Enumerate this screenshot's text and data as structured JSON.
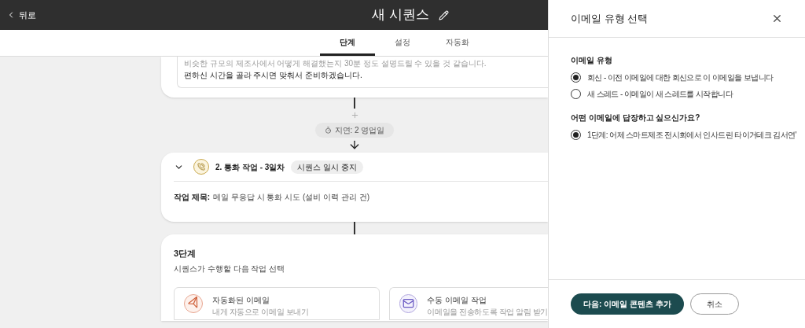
{
  "header": {
    "back": "뒤로",
    "title": "새 시퀀스"
  },
  "tabs": [
    {
      "label": "단계",
      "selected": true
    },
    {
      "label": "설정",
      "selected": false
    },
    {
      "label": "자동화",
      "selected": false
    }
  ],
  "step_1_editor": {
    "lines": [
      "비슷한 규모의 제조사에서 어떻게 해결했는지 30분 정도 설명드릴 수 있을 것 같습니다.",
      "편하신 시간을 골라 주시면 맞춰서 준비하겠습니다."
    ]
  },
  "delay": {
    "label": "지연: 2 영업일"
  },
  "step_2": {
    "title": "2. 통화 작업 - 3일차",
    "badge": "시퀀스 일시 중지",
    "expanded": true,
    "task_label": "작업 제목:",
    "task_value": "메일 무응답 시 통화 시도 (설비 이력 관리 건)"
  },
  "step_3": {
    "title": "3단계",
    "subtitle": "시퀀스가 수행할 다음 작업 선택",
    "options": [
      {
        "kind": "auto_email",
        "title": "자동화된 이메일",
        "description": "내게 자동으로 이메일 보내기"
      },
      {
        "kind": "manual_email",
        "title": "수동 이메일 작업",
        "description": "이메일을 전송하도록 작업 알림 받기"
      }
    ]
  },
  "panel": {
    "title": "이메일 유형 선택",
    "sections": [
      {
        "label": "이메일 유형",
        "options": [
          {
            "label": "회신 - 이전 이메일에 대한 회신으로 이 이메일을 보냅니다",
            "selected": true
          },
          {
            "label": "새 스레드 - 이메일이 새 스레드를 시작합니다",
            "selected": false
          }
        ]
      },
      {
        "label": "어떤 이메일에 답장하고 싶으신가요?",
        "options": [
          {
            "label": "1단계: 어제 스마트제조 전시회에서 인사드린 타이거테크 김서연'",
            "selected": true
          }
        ]
      }
    ],
    "primary_button": "다음: 이메일 콘텐츠 추가",
    "secondary_button": "취소"
  }
}
